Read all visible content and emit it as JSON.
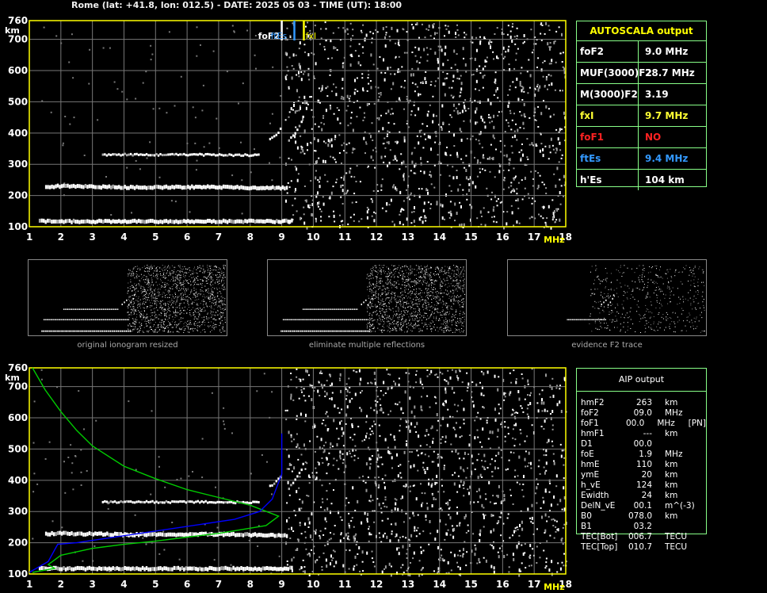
{
  "header": "Rome (lat: +41.8, lon: 012.5) - DATE: 2025 05 03 - TIME (UT): 18:00",
  "axis": {
    "y_unit": "km",
    "x_unit": "MHz",
    "y_ticks": [
      "100",
      "200",
      "300",
      "400",
      "500",
      "600",
      "700",
      "760"
    ],
    "x_ticks": [
      "1",
      "2",
      "3",
      "4",
      "5",
      "6",
      "7",
      "8",
      "9",
      "10",
      "11",
      "12",
      "13",
      "14",
      "15",
      "16",
      "17",
      "18"
    ]
  },
  "markers": {
    "foF2": "foF2",
    "ftEs": "ftEs",
    "fxI": "fxI"
  },
  "autoscala": {
    "title": "AUTOSCALA output",
    "rows": [
      {
        "label": "foF2",
        "value": "9.0 MHz",
        "color": "#ffffff"
      },
      {
        "label": "MUF(3000)F2",
        "value": "28.7 MHz",
        "color": "#ffffff"
      },
      {
        "label": "M(3000)F2",
        "value": "3.19",
        "color": "#ffffff"
      },
      {
        "label": "fxI",
        "value": "9.7 MHz",
        "color": "#ffff33"
      },
      {
        "label": "foF1",
        "value": "NO",
        "color": "#ff2222"
      },
      {
        "label": "ftEs",
        "value": "9.4 MHz",
        "color": "#3399ff"
      },
      {
        "label": "h'Es",
        "value": "104    km",
        "color": "#ffffff"
      }
    ]
  },
  "thumbs": [
    "original ionogram resized",
    "eliminate multiple reflections",
    "evidence F2 trace"
  ],
  "aip": {
    "title": "AIP output",
    "rows": [
      [
        "hmF2",
        "263",
        "km",
        ""
      ],
      [
        "foF2",
        "09.0",
        "MHz",
        ""
      ],
      [
        "foF1",
        "00.0",
        "MHz",
        "[PN]"
      ],
      [
        "hmF1",
        "---",
        "km",
        ""
      ],
      [
        "D1",
        "00.0",
        "",
        ""
      ],
      [
        "foE",
        "1.9",
        "MHz",
        ""
      ],
      [
        "hmE",
        "110",
        "km",
        ""
      ],
      [
        "ymE",
        "20",
        "km",
        ""
      ],
      [
        "h_vE",
        "124",
        "km",
        ""
      ],
      [
        "Ewidth",
        "24",
        "km",
        ""
      ],
      [
        "DelN_vE",
        "00.1",
        "m^(-3)",
        ""
      ],
      [
        "B0",
        "078.0",
        "km",
        ""
      ],
      [
        "B1",
        "03.2",
        "",
        ""
      ],
      [
        "TEC[Bot]",
        "006.7",
        "TECU",
        ""
      ],
      [
        "TEC[Top]",
        "010.7",
        "TECU",
        ""
      ]
    ]
  },
  "chart_data": [
    {
      "type": "scatter",
      "title": "",
      "xlim": [
        1,
        18
      ],
      "ylim": [
        100,
        760
      ],
      "xlabel": "MHz",
      "ylabel": "km",
      "grid": true,
      "series": [
        {
          "values": [
            [
              1.3,
              118
            ],
            [
              2,
              117
            ],
            [
              3,
              117
            ],
            [
              4,
              117
            ],
            [
              5,
              117
            ],
            [
              6,
              117
            ],
            [
              7,
              117
            ],
            [
              8,
              117
            ],
            [
              9,
              117
            ],
            [
              9.35,
              118
            ]
          ]
        },
        {
          "values": [
            [
              1.5,
              228
            ],
            [
              2,
              230
            ],
            [
              3,
              228
            ],
            [
              4,
              226
            ],
            [
              5,
              226
            ],
            [
              6,
              227
            ],
            [
              7,
              227
            ],
            [
              8,
              225
            ],
            [
              9,
              224
            ],
            [
              9.2,
              224
            ]
          ]
        },
        {
          "values": [
            [
              3.3,
              330
            ],
            [
              4,
              331
            ],
            [
              5,
              330
            ],
            [
              6,
              331
            ],
            [
              7,
              330
            ],
            [
              8,
              329
            ],
            [
              8.3,
              330
            ]
          ]
        },
        {
          "values": [
            [
              8.6,
              380
            ],
            [
              8.8,
              395
            ],
            [
              9.0,
              420
            ]
          ]
        },
        {
          "values": [
            [
              9.2,
              375
            ],
            [
              9.4,
              400
            ],
            [
              9.6,
              435
            ],
            [
              9.7,
              470
            ]
          ]
        }
      ]
    },
    {
      "type": "line",
      "title": "",
      "xlim": [
        1,
        18
      ],
      "ylim": [
        100,
        760
      ],
      "xlabel": "MHz",
      "ylabel": "km",
      "series": [
        {
          "color": "#00cc00",
          "values": [
            [
              1.1,
              760
            ],
            [
              1.5,
              690
            ],
            [
              2,
              620
            ],
            [
              2.5,
              560
            ],
            [
              3,
              510
            ],
            [
              4,
              445
            ],
            [
              5,
              405
            ],
            [
              6,
              370
            ],
            [
              7,
              345
            ],
            [
              8,
              320
            ],
            [
              8.9,
              285
            ],
            [
              8.5,
              255
            ],
            [
              7,
              230
            ],
            [
              6,
              218
            ],
            [
              5,
              205
            ],
            [
              4,
              195
            ],
            [
              3,
              182
            ],
            [
              2,
              160
            ],
            [
              1.6,
              130
            ],
            [
              1.8,
              118
            ],
            [
              1.1,
              105
            ]
          ]
        },
        {
          "color": "#0000ff",
          "values": [
            [
              1,
              105
            ],
            [
              1.6,
              140
            ],
            [
              1.9,
              195
            ],
            [
              2.5,
              200
            ],
            [
              3.5,
              215
            ],
            [
              4.5,
              230
            ],
            [
              5.5,
              245
            ],
            [
              6.5,
              260
            ],
            [
              7.5,
              275
            ],
            [
              8.3,
              300
            ],
            [
              8.7,
              340
            ],
            [
              9,
              420
            ],
            [
              9,
              490
            ],
            [
              9,
              550
            ]
          ]
        }
      ]
    }
  ]
}
